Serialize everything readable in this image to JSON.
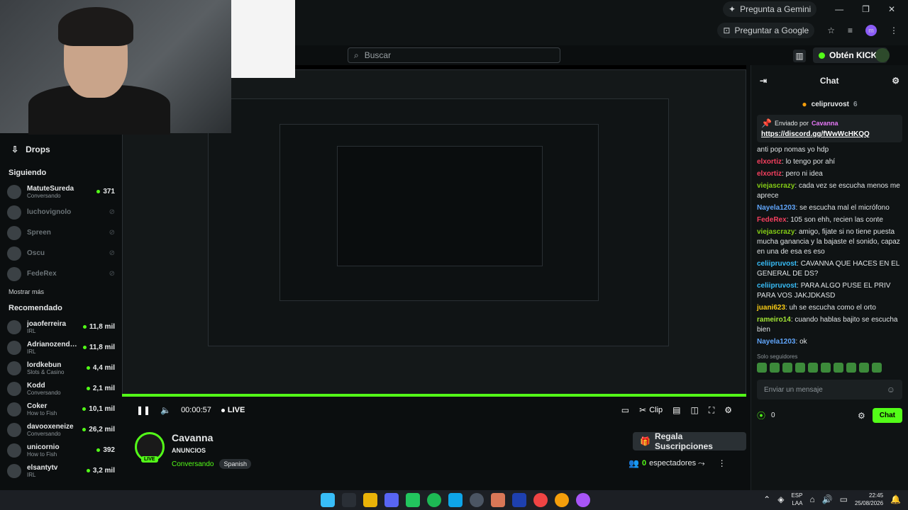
{
  "browser": {
    "gemini_label": "Pregunta a Gemini",
    "google_label": "Preguntar a Google",
    "profile_initial": "m"
  },
  "kick": {
    "search_placeholder": "Buscar",
    "obtain_label": "Obtén KICKs"
  },
  "sidebar": {
    "drops_label": "Drops",
    "following_heading": "Siguiendo",
    "show_more": "Mostrar más",
    "recommended_heading": "Recomendado",
    "following": [
      {
        "name": "MatuteSureda",
        "category": "Conversando",
        "viewers": "371",
        "online": true
      },
      {
        "name": "luchovignolo",
        "category": "",
        "viewers": "",
        "online": false
      },
      {
        "name": "Spreen",
        "category": "",
        "viewers": "",
        "online": false
      },
      {
        "name": "Oscu",
        "category": "",
        "viewers": "",
        "online": false
      },
      {
        "name": "FedeRex",
        "category": "",
        "viewers": "",
        "online": false
      }
    ],
    "recommended": [
      {
        "name": "joaoferreira",
        "category": "IRL",
        "viewers": "11,8 mil"
      },
      {
        "name": "Adrianozendej...",
        "category": "IRL",
        "viewers": "11,8 mil"
      },
      {
        "name": "lordkebun",
        "category": "Slots & Casino",
        "viewers": "4,4 mil"
      },
      {
        "name": "Kodd",
        "category": "Conversando",
        "viewers": "2,1 mil"
      },
      {
        "name": "Coker",
        "category": "How to Fish",
        "viewers": "10,1 mil"
      },
      {
        "name": "davooxeneize",
        "category": "Conversando",
        "viewers": "26,2 mil"
      },
      {
        "name": "unicornio",
        "category": "How to Fish",
        "viewers": "392"
      },
      {
        "name": "elsantytv",
        "category": "IRL",
        "viewers": "3,2 mil"
      }
    ]
  },
  "player": {
    "time": "00:00:57",
    "live_label": "LIVE",
    "clip_label": "Clip"
  },
  "stream": {
    "streamer": "Cavanna",
    "title": "ANUNCIOS",
    "category": "Conversando",
    "language": "Spanish",
    "live_badge": "LIVE",
    "gift_label": "Regala Suscripciones",
    "viewers_count": "0",
    "viewers_label": "espectadores"
  },
  "chat": {
    "title": "Chat",
    "leader": "celipruvost",
    "leader_count": "6",
    "pinned_by_label": "Enviado por",
    "pinned_by": "Cavanna",
    "pinned_link": "https://discord.gg/fWwWcHKQQ",
    "partial_top": "anti pop nomas yo hdp",
    "messages": [
      {
        "user": "elxortiz",
        "color": "#f43f5e",
        "text": "lo tengo por ahí"
      },
      {
        "user": "elxortiz",
        "color": "#f43f5e",
        "text": "pero ni idea"
      },
      {
        "user": "viejascrazy",
        "color": "#84cc16",
        "text": "cada vez se escucha menos me aprece"
      },
      {
        "user": "Nayela1203",
        "color": "#60a5fa",
        "text": "se escucha mal el micrófono"
      },
      {
        "user": "FedeRex",
        "color": "#f43f5e",
        "text": "105 son ehh, recien las conte"
      },
      {
        "user": "viejascrazy",
        "color": "#84cc16",
        "text": "amigo, fijate si no tiene puesta mucha ganancia y la bajaste el sonido, capaz en una de esa es eso"
      },
      {
        "user": "celiipruvost",
        "color": "#38bdf8",
        "text": "CAVANNA QUE HACES EN EL GENERAL DE DS?"
      },
      {
        "user": "celiipruvost",
        "color": "#38bdf8",
        "text": "PARA ALGO PUSE EL PRIV PARA VOS JAKJDKASD"
      },
      {
        "user": "juani623",
        "color": "#facc15",
        "text": "uh se escucha como el orto"
      },
      {
        "user": "rameiro14",
        "color": "#a3e635",
        "text": "cuando hablas bajito se escucha bien"
      },
      {
        "user": "Nayela1203",
        "color": "#60a5fa",
        "text": "ok"
      }
    ],
    "followers_only": "Solo seguidores",
    "input_placeholder": "Enviar un mensaje",
    "kicks_count": "0",
    "send_label": "Chat"
  },
  "taskbar": {
    "lang": "ESP",
    "lang_sub": "LAA",
    "time": "22:45",
    "date": "25/08/2026"
  }
}
